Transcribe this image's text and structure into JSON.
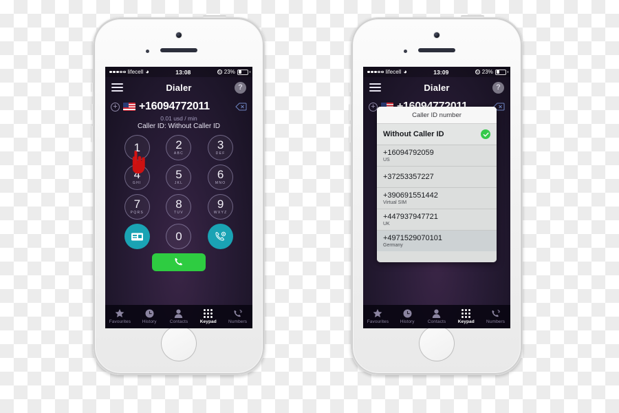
{
  "phone_left": {
    "status_bar": {
      "carrier": "lifecell",
      "wifi_icon": "wifi-icon",
      "time": "13:08",
      "battery_text": "23%",
      "lock_icon": "rotation-lock-icon"
    },
    "nav": {
      "menu_icon": "hamburger-menu-icon",
      "title": "Dialer",
      "help_label": "?"
    },
    "dial": {
      "add_icon": "add-contact-icon",
      "flag_icon": "us-flag-icon",
      "number": "+16094772011",
      "backspace_icon": "backspace-icon",
      "rate": "0.01 usd / min",
      "caller_id": "Caller ID: Without Caller ID"
    },
    "keys": [
      {
        "digit": "1",
        "letters": ""
      },
      {
        "digit": "2",
        "letters": "ABC"
      },
      {
        "digit": "3",
        "letters": "DEF"
      },
      {
        "digit": "4",
        "letters": "GHI"
      },
      {
        "digit": "5",
        "letters": "JKL"
      },
      {
        "digit": "6",
        "letters": "MNO"
      },
      {
        "digit": "7",
        "letters": "PQRS"
      },
      {
        "digit": "8",
        "letters": "TUV"
      },
      {
        "digit": "9",
        "letters": "WXYZ"
      },
      {
        "digit": "",
        "letters": "",
        "icon": "caller-id-card-icon"
      },
      {
        "digit": "0",
        "letters": ""
      },
      {
        "digit": "",
        "letters": "",
        "icon": "call-settings-icon"
      }
    ],
    "call_button_icon": "phone-handset-icon",
    "cursor_icon": "pointing-hand-cursor",
    "tabs": [
      {
        "label": "Favourites",
        "icon": "star-icon",
        "active": false
      },
      {
        "label": "History",
        "icon": "clock-icon",
        "active": false
      },
      {
        "label": "Contacts",
        "icon": "person-icon",
        "active": false
      },
      {
        "label": "Keypad",
        "icon": "keypad-grid-icon",
        "active": true
      },
      {
        "label": "Numbers",
        "icon": "phone-waves-icon",
        "active": false
      }
    ]
  },
  "phone_right": {
    "status_bar": {
      "carrier": "lifecell",
      "wifi_icon": "wifi-icon",
      "time": "13:09",
      "battery_text": "23%",
      "lock_icon": "rotation-lock-icon"
    },
    "nav": {
      "menu_icon": "hamburger-menu-icon",
      "title": "Dialer",
      "help_label": "?"
    },
    "dial": {
      "add_icon": "add-contact-icon",
      "flag_icon": "us-flag-icon",
      "number": "+16094772011",
      "backspace_icon": "backspace-icon"
    },
    "sheet": {
      "title": "Caller ID number",
      "items": [
        {
          "title": "Without Caller ID",
          "subtitle": "",
          "selected": true,
          "highlighted": false
        },
        {
          "title": "+16094792059",
          "subtitle": "US",
          "selected": false,
          "highlighted": false
        },
        {
          "title": "+37253357227",
          "subtitle": "",
          "selected": false,
          "highlighted": false
        },
        {
          "title": "+390691551442",
          "subtitle": "Virtual SIM",
          "selected": false,
          "highlighted": false
        },
        {
          "title": "+447937947721",
          "subtitle": "UK",
          "selected": false,
          "highlighted": false
        },
        {
          "title": "+4971529070101",
          "subtitle": "Germany",
          "selected": false,
          "highlighted": true
        }
      ],
      "check_icon": "green-check-icon"
    },
    "tabs": [
      {
        "label": "Favourites",
        "icon": "star-icon",
        "active": false
      },
      {
        "label": "History",
        "icon": "clock-icon",
        "active": false
      },
      {
        "label": "Contacts",
        "icon": "person-icon",
        "active": false
      },
      {
        "label": "Keypad",
        "icon": "keypad-grid-icon",
        "active": true
      },
      {
        "label": "Numbers",
        "icon": "phone-waves-icon",
        "active": false
      }
    ]
  },
  "colors": {
    "teal": "#1aa3b4",
    "green_call": "#2ecc41",
    "green_check": "#35c94a",
    "screen_bg": "#2a1d38",
    "cursor_red": "#cc1111"
  }
}
